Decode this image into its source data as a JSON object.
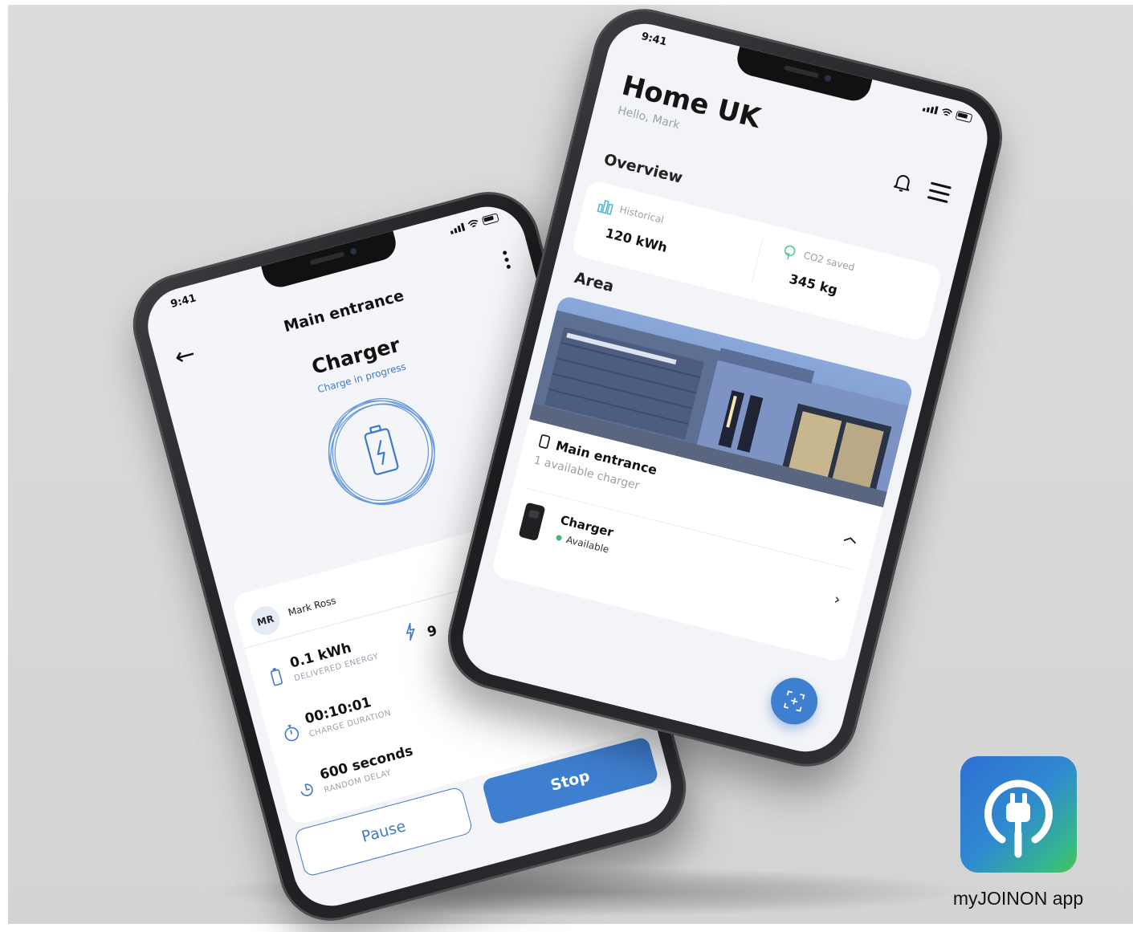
{
  "left_phone": {
    "status_time": "9:41",
    "header_title": "Main entrance",
    "charger_title": "Charger",
    "charger_status": "Charge in progress",
    "user_initials": "MR",
    "user_name": "Mark Ross",
    "stats": [
      {
        "value": "0.1 kWh",
        "label": "DELIVERED ENERGY"
      },
      {
        "value": "00:10:01",
        "label": "CHARGE DURATION"
      },
      {
        "value": "600 seconds",
        "label": "RANDOM DELAY"
      }
    ],
    "partial_stat_value": "9",
    "pause_label": "Pause",
    "stop_label": "Stop"
  },
  "right_phone": {
    "status_time": "9:41",
    "title": "Home UK",
    "greeting": "Hello, Mark",
    "overview_heading": "Overview",
    "overview": [
      {
        "label": "Historical",
        "value": "120 kWh",
        "icon": "building-chart-icon"
      },
      {
        "label": "CO2 saved",
        "value": "345 kg",
        "icon": "tree-icon"
      }
    ],
    "area_heading": "Area",
    "location_name": "Main entrance",
    "location_sub": "1 available charger",
    "charger_name": "Charger",
    "charger_status": "Available"
  },
  "colors": {
    "accent": "#3f7fd0",
    "available": "#3dbb7a",
    "background": "#d9d9d9"
  },
  "app": {
    "caption": "myJOINON app",
    "icon": "plug-power-icon"
  }
}
